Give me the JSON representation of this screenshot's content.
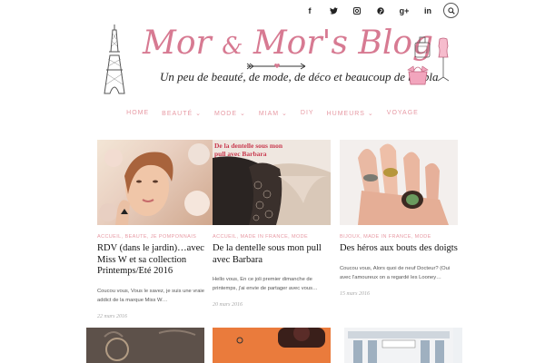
{
  "social": {
    "icons": [
      "facebook-icon",
      "twitter-icon",
      "instagram-icon",
      "pinterest-icon",
      "googleplus-icon",
      "linkedin-icon",
      "search-icon"
    ],
    "glyphs": [
      "f",
      "t",
      "◘",
      "p",
      "g+",
      "in"
    ]
  },
  "header": {
    "title_left": "Mor",
    "title_amp": "&",
    "title_right": "Mor's Blog",
    "tagline": "Un peu de beauté, de mode, de déco et beaucoup de blabla"
  },
  "nav": {
    "items": [
      "HOME",
      "BEAUTÉ",
      "MODE",
      "MIAM",
      "DIY",
      "HUMEURS",
      "VOYAGE"
    ],
    "dropdown": [
      "BEAUTÉ",
      "MODE",
      "MIAM",
      "HUMEURS"
    ]
  },
  "posts": [
    {
      "categories": "ACCUEIL, BEAUTÉ, JE POMPONNAIS",
      "title": "RDV (dans le jardin)…avec Miss W et sa collection Printemps/Eté 2016",
      "excerpt": "Coucou vous, Vous le savez, je suis une vraie addict de la marque Miss W…",
      "date": "22 mars 2016"
    },
    {
      "categories": "ACCUEIL, MADE IN FRANCE, MODE",
      "title": "De la dentelle sous mon pull avec Barbara",
      "overlay": "De la dentelle sous mon pull avec Barbara",
      "excerpt": "Hello vous, En ce joli premier dimanche de printemps, j'ai envie de partager avec vous…",
      "date": "20 mars 2016"
    },
    {
      "categories": "BIJOUX, MADE IN FRANCE, MODE",
      "title": "Des héros aux bouts des doigts",
      "excerpt": "Coucou vous, Alors quoi de neuf Docteur? (Oui avec l'amoureux on a regardé les Looney…",
      "date": "15 mars 2016"
    }
  ],
  "colors": {
    "accent": "#e79aa4",
    "title_pink": "#d77a92"
  }
}
